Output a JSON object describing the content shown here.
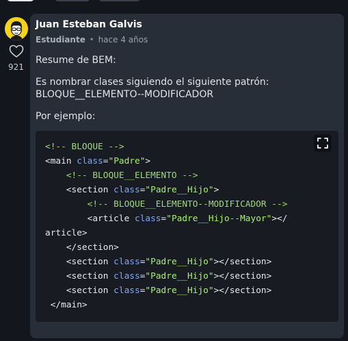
{
  "comment": {
    "author": "Juan Esteban Galvis",
    "role": "Estudiante",
    "separator": "•",
    "time_ago": "hace 4 años",
    "likes": "921",
    "paragraphs": [
      "Resume de BEM:",
      "Es nombrar clases siguiendo el siguiente patrón:",
      "BLOQUE__ELEMENTO--MODIFICADOR",
      "Por ejemplo:"
    ]
  },
  "code": {
    "lines": [
      [
        {
          "t": "cm",
          "s": "<!-- BLOQUE -->"
        }
      ],
      [
        {
          "t": "tx",
          "s": "<main "
        },
        {
          "t": "at",
          "s": "class"
        },
        {
          "t": "tx",
          "s": "="
        },
        {
          "t": "st",
          "s": "\"Padre\""
        },
        {
          "t": "tx",
          "s": ">"
        }
      ],
      [
        {
          "t": "tx",
          "s": "    "
        },
        {
          "t": "cm",
          "s": "<!-- BLOQUE__ELEMENTO -->"
        }
      ],
      [
        {
          "t": "tx",
          "s": "    <section "
        },
        {
          "t": "at",
          "s": "class"
        },
        {
          "t": "tx",
          "s": "="
        },
        {
          "t": "st",
          "s": "\"Padre__Hijo\""
        },
        {
          "t": "tx",
          "s": ">"
        }
      ],
      [
        {
          "t": "tx",
          "s": "        "
        },
        {
          "t": "cm",
          "s": "<!-- BLOQUE__ELEMENTO--MODIFICADOR -->"
        }
      ],
      [
        {
          "t": "tx",
          "s": "        <article "
        },
        {
          "t": "at",
          "s": "class"
        },
        {
          "t": "tx",
          "s": "="
        },
        {
          "t": "st",
          "s": "\"Padre__Hijo--Mayor\""
        },
        {
          "t": "tx",
          "s": "></"
        }
      ],
      [
        {
          "t": "tx",
          "s": "article>"
        }
      ],
      [
        {
          "t": "tx",
          "s": "    </section>"
        }
      ],
      [
        {
          "t": "tx",
          "s": "    <section "
        },
        {
          "t": "at",
          "s": "class"
        },
        {
          "t": "tx",
          "s": "="
        },
        {
          "t": "st",
          "s": "\"Padre__Hijo\""
        },
        {
          "t": "tx",
          "s": "></section>"
        }
      ],
      [
        {
          "t": "tx",
          "s": "    <section "
        },
        {
          "t": "at",
          "s": "class"
        },
        {
          "t": "tx",
          "s": "="
        },
        {
          "t": "st",
          "s": "\"Padre__Hijo\""
        },
        {
          "t": "tx",
          "s": "></section>"
        }
      ],
      [
        {
          "t": "tx",
          "s": "    <section "
        },
        {
          "t": "at",
          "s": "class"
        },
        {
          "t": "tx",
          "s": "="
        },
        {
          "t": "st",
          "s": "\"Padre__Hijo\""
        },
        {
          "t": "tx",
          "s": "></section>"
        }
      ],
      [
        {
          "t": "tx",
          "s": " </main>"
        }
      ]
    ]
  },
  "icons": {
    "like": "heart-outline-icon",
    "expand": "fullscreen-expand-icon",
    "avatar": "user-avatar-illustration"
  },
  "colors": {
    "page_background": "#13161c",
    "card_background": "#282e38",
    "code_background": "#181b22",
    "avatar_background": "#f5d31a",
    "code_comment": "#9fd97b",
    "code_attribute": "#7fa8f5",
    "code_string": "#a6f072"
  }
}
